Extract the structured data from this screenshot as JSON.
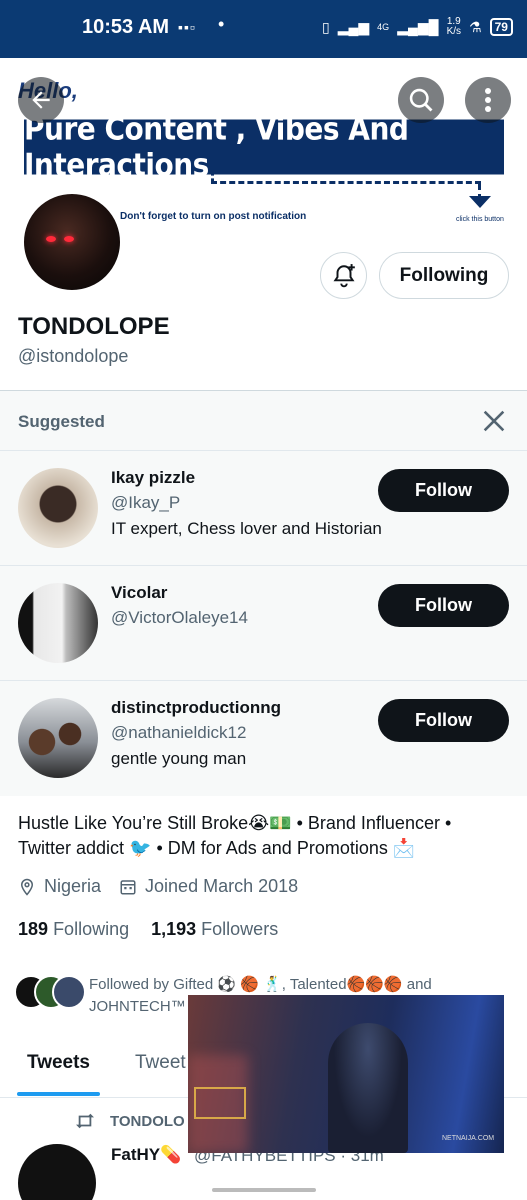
{
  "status_bar": {
    "time": "10:53 AM",
    "net_speed_value": "1.9",
    "net_speed_unit": "K/s",
    "battery": "79",
    "network_label": "4G"
  },
  "banner": {
    "hello_text": "Hello,",
    "headline": "Pure Content , Vibes And Interactions",
    "notification_text": "Don't forget to turn on post notification",
    "click_text": "click this button"
  },
  "profile": {
    "name": "TONDOLOPE",
    "handle": "@istondolope",
    "following_button": "Following"
  },
  "suggested": {
    "title": "Suggested",
    "items": [
      {
        "name": "Ikay pizzle",
        "handle": "@Ikay_P",
        "bio": "IT expert, Chess lover and Historian",
        "button": "Follow"
      },
      {
        "name": "Vicolar",
        "handle": "@VictorOlaleye14",
        "bio": "",
        "button": "Follow"
      },
      {
        "name": "distinctproductionng",
        "handle": "@nathanieldick12",
        "bio": "gentle young man",
        "button": "Follow"
      }
    ]
  },
  "bio": {
    "line1": "Hustle Like You’re Still Broke😭💵 • Brand Influencer •",
    "line2": "Twitter addict 🐦 • DM for Ads and Promotions 📩",
    "location": "Nigeria",
    "joined": "Joined March 2018"
  },
  "stats": {
    "following_count": "189",
    "following_label": "Following",
    "followers_count": "1,193",
    "followers_label": "Followers"
  },
  "followed_by": {
    "text_line1": "Followed by Gifted ⚽ 🏀 🕺, Talented🏀🏀🏀 and",
    "text_line2": "JOHNTECH™"
  },
  "tabs": {
    "tweets": "Tweets",
    "replies": "Tweet"
  },
  "tweet": {
    "retweeted_by": "TONDOLO",
    "author": "FatHY💊",
    "handle": "@FATHYBETTIPS · 31m"
  },
  "video": {
    "watermark": "NETNAIJA.COM"
  },
  "colors": {
    "status_bar": "#0b3a73",
    "banner_headline": "#0b2f66",
    "follow_button": "#0f1419",
    "tab_indicator": "#1d9bf0"
  }
}
